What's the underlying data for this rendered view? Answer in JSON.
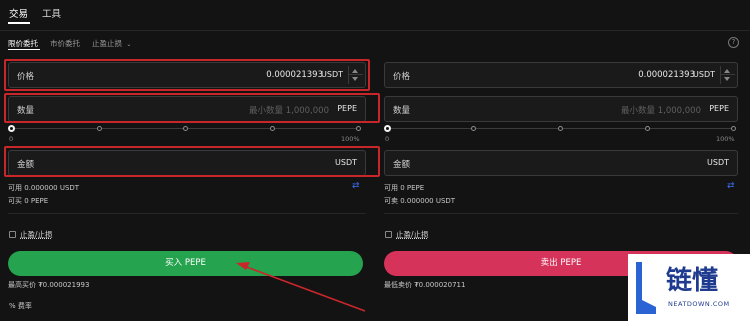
{
  "tabs": {
    "trade": "交易",
    "tools": "工具"
  },
  "order_tabs": {
    "limit": "限价委托",
    "market": "市价委托",
    "stop": "止盈止损"
  },
  "help_icon": "?",
  "buy": {
    "price_label": "价格",
    "price_value": "0.000021393",
    "price_unit": "USDT",
    "qty_label": "数量",
    "qty_placeholder": "最小数量 1,000,000",
    "qty_unit": "PEPE",
    "slider_min": "0",
    "slider_max": "100%",
    "amount_label": "金额",
    "amount_unit": "USDT",
    "available": "可用 0.000000 USDT",
    "can_buy": "可买 0 PEPE",
    "tp_sl": "止盈/止损",
    "button": "买入 PEPE",
    "best_price": "最高买价 ₮0.000021993",
    "fee": "% 费率"
  },
  "sell": {
    "price_label": "价格",
    "price_value": "0.000021393",
    "price_unit": "USDT",
    "qty_label": "数量",
    "qty_placeholder": "最小数量 1,000,000",
    "qty_unit": "PEPE",
    "slider_min": "0",
    "slider_max": "100%",
    "amount_label": "金额",
    "amount_unit": "USDT",
    "available": "可用 0 PEPE",
    "can_sell": "可卖 0.000000 USDT",
    "tp_sl": "止盈/止损",
    "button": "卖出 PEPE",
    "best_price": "最低卖价 ₮0.000020711"
  },
  "watermark": {
    "brand": "链懂",
    "site": "NEATDOWN.COM"
  },
  "colors": {
    "buy": "#25a34f",
    "sell": "#d6335b",
    "highlight": "#c8272a",
    "swap_icon": "#3b6ef5"
  },
  "icons": {
    "swap": "swap-icon",
    "help": "help-icon",
    "dropdown": "chevron-down-icon"
  }
}
